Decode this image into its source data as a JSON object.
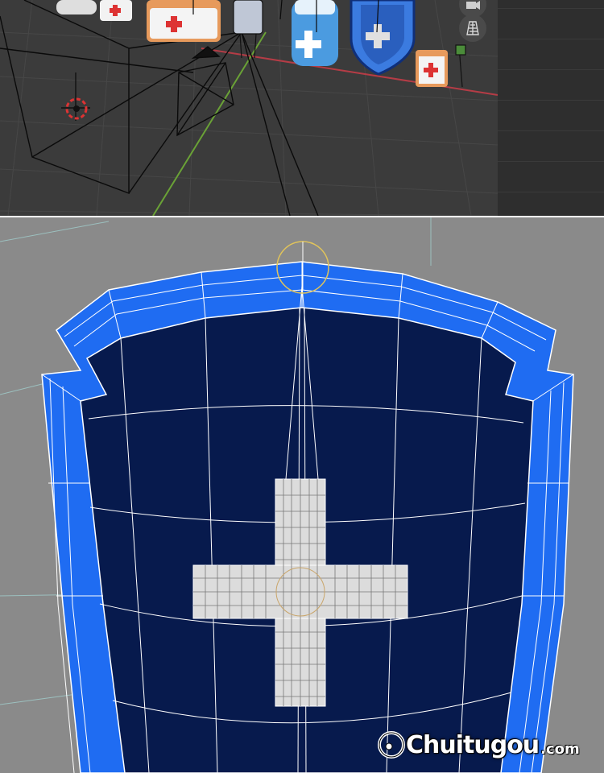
{
  "colors": {
    "viewport_bg": "#3b3b3b",
    "grid_line": "#454545",
    "x_axis": "#b53c46",
    "y_axis": "#6aa236",
    "sidebar_bg": "#2e2e2e",
    "edit_bg": "#8a8a8a",
    "shield_inner": "#071a4d",
    "shield_rim": "#1f6cf2",
    "wire": "#ffffff",
    "cross_face": "#e8e8e8",
    "selection_ring": "#e1c45a"
  },
  "icons": {
    "navigation_gizmo": "camera-icon",
    "perspective_gizmo": "grid-icon",
    "origin_marker": "crosshair-icon",
    "camera": "camera-object-icon"
  },
  "watermark": {
    "brand": "Chuitugou",
    "domain": ".com"
  }
}
